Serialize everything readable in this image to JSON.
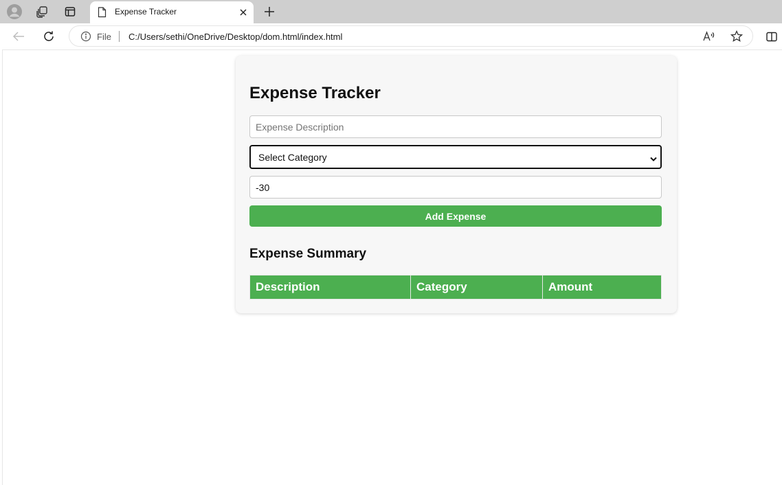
{
  "browser": {
    "tab": {
      "title": "Expense Tracker"
    },
    "address": {
      "scheme_label": "File",
      "url": "C:/Users/sethi/OneDrive/Desktop/dom.html/index.html"
    }
  },
  "page": {
    "title": "Expense Tracker",
    "form": {
      "description_placeholder": "Expense Description",
      "description_value": "",
      "category_selected": "Select Category",
      "amount_value": "-30",
      "add_button_label": "Add Expense"
    },
    "summary": {
      "title": "Expense Summary",
      "columns": [
        "Description",
        "Category",
        "Amount"
      ],
      "rows": []
    }
  },
  "colors": {
    "accent_green": "#4caf50",
    "card_background": "#f7f7f7",
    "tabstrip_background": "#cfcfcf"
  },
  "icons": [
    "profile-icon",
    "workspaces-icon",
    "tab-actions-icon",
    "page-icon",
    "close-icon",
    "plus-icon",
    "back-icon",
    "refresh-icon",
    "info-icon",
    "read-aloud-icon",
    "favorite-star-icon",
    "split-screen-icon",
    "chevron-down-icon"
  ]
}
